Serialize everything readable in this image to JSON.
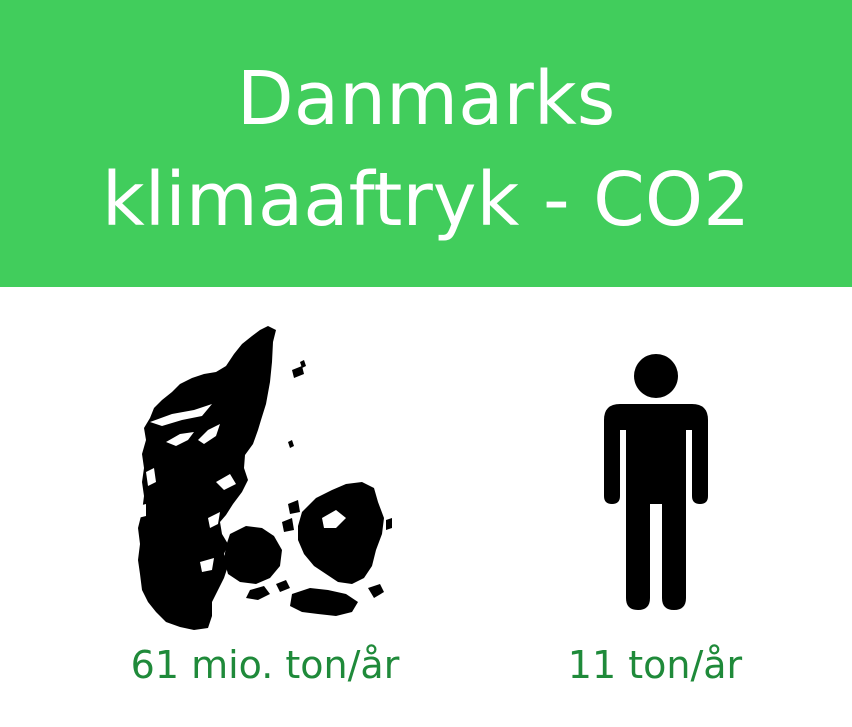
{
  "header": {
    "title_line1": "Danmarks",
    "title_line2": "klimaaftryk - CO2",
    "background_color": "#41cd5c"
  },
  "country": {
    "icon": "denmark-map-icon",
    "value_label": "61 mio. ton/år"
  },
  "person": {
    "icon": "person-icon",
    "value_label": "11 ton/år"
  },
  "colors": {
    "accent_text": "#1f8a3a",
    "icon_fill": "#000000"
  }
}
